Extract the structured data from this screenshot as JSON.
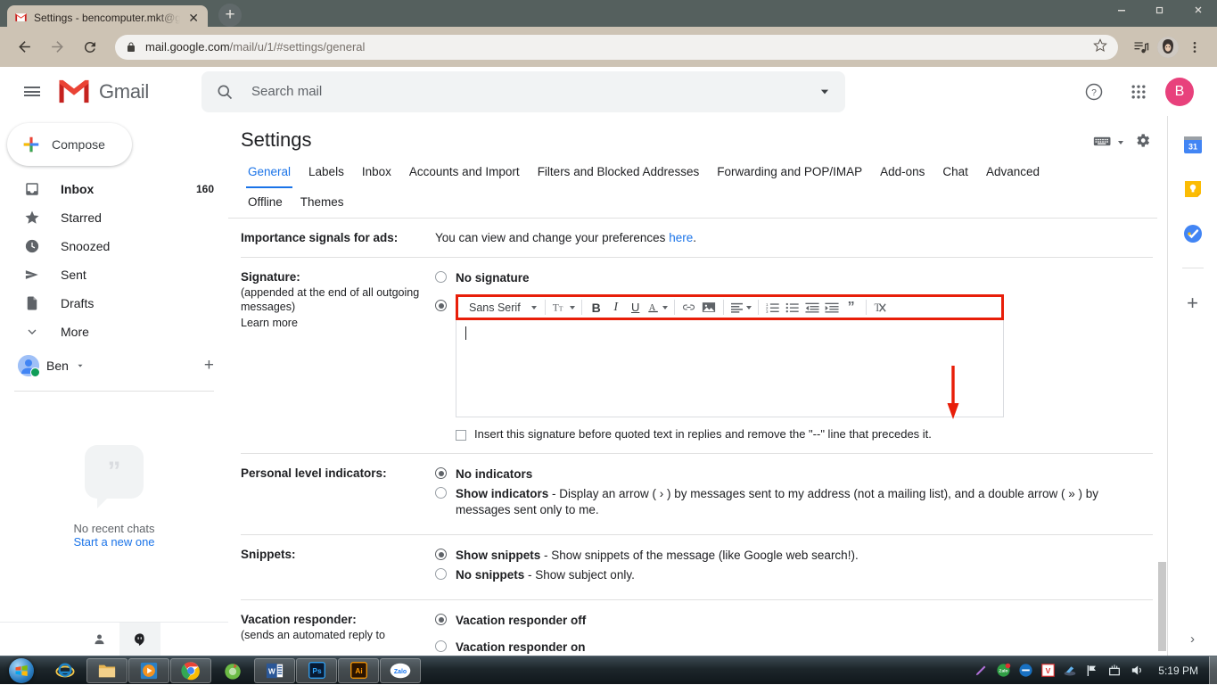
{
  "browser": {
    "tab_title": "Settings - bencomputer.mkt@gm",
    "tab_favicon": "gmail-icon",
    "new_tab_label": "+",
    "close_tab_label": "✕",
    "url_main": "mail.google.com",
    "url_path": "/mail/u/1/#settings/general",
    "window_minimize": "—",
    "window_maximize": "❐",
    "window_close": "✕"
  },
  "gmail": {
    "logo_text": "Gmail",
    "search_placeholder": "Search mail",
    "search_value": "",
    "compose_label": "Compose",
    "account_initial": "B",
    "nav": [
      {
        "label": "Inbox",
        "count": "160",
        "icon": "inbox-icon",
        "selected": true
      },
      {
        "label": "Starred",
        "count": "",
        "icon": "star-icon",
        "selected": false
      },
      {
        "label": "Snoozed",
        "count": "",
        "icon": "clock-icon",
        "selected": false
      },
      {
        "label": "Sent",
        "count": "",
        "icon": "send-icon",
        "selected": false
      },
      {
        "label": "Drafts",
        "count": "",
        "icon": "document-icon",
        "selected": false
      },
      {
        "label": "More",
        "count": "",
        "icon": "chevron-down-icon",
        "selected": false
      }
    ],
    "chat_user": "Ben",
    "chat_empty_text": "No recent chats",
    "chat_start_link": "Start a new one"
  },
  "settings": {
    "title": "Settings",
    "tabs_row1": [
      {
        "label": "General",
        "active": true
      },
      {
        "label": "Labels",
        "active": false
      },
      {
        "label": "Inbox",
        "active": false
      },
      {
        "label": "Accounts and Import",
        "active": false
      },
      {
        "label": "Filters and Blocked Addresses",
        "active": false
      },
      {
        "label": "Forwarding and POP/IMAP",
        "active": false
      },
      {
        "label": "Add-ons",
        "active": false
      },
      {
        "label": "Chat",
        "active": false
      },
      {
        "label": "Advanced",
        "active": false
      }
    ],
    "tabs_row2": [
      {
        "label": "Offline",
        "active": false
      },
      {
        "label": "Themes",
        "active": false
      }
    ],
    "importance": {
      "label": "Importance signals for ads:",
      "text": "You can view and change your preferences ",
      "link": "here",
      "text_end": "."
    },
    "signature": {
      "label": "Signature:",
      "sub": "(appended at the end of all outgoing messages)",
      "learn_more": "Learn more",
      "option_none": "No signature",
      "option_none_selected": false,
      "editor_selected": true,
      "font_name": "Sans Serif",
      "content": "",
      "checkbox_label": "Insert this signature before quoted text in replies and remove the \"--\" line that precedes it.",
      "checkbox_checked": false,
      "toolbar": [
        "font-family-selector",
        "font-size-icon",
        "bold-icon",
        "italic-icon",
        "underline-icon",
        "text-color-icon",
        "link-icon",
        "insert-image-icon",
        "align-icon",
        "numbered-list-icon",
        "bulleted-list-icon",
        "indent-less-icon",
        "indent-more-icon",
        "quote-icon",
        "remove-formatting-icon"
      ]
    },
    "personal_indicators": {
      "label": "Personal level indicators:",
      "option_no": "No indicators",
      "option_no_selected": true,
      "option_show_bold": "Show indicators",
      "option_show_rest": " - Display an arrow ( › ) by messages sent to my address (not a mailing list), and a double arrow ( » ) by messages sent only to me.",
      "option_show_selected": false
    },
    "snippets": {
      "label": "Snippets:",
      "option_show_bold": "Show snippets",
      "option_show_rest": " - Show snippets of the message (like Google web search!).",
      "option_show_selected": true,
      "option_no_bold": "No snippets",
      "option_no_rest": " - Show subject only.",
      "option_no_selected": false
    },
    "vacation": {
      "label": "Vacation responder:",
      "sub": "(sends an automated reply to",
      "option_off": "Vacation responder off",
      "option_off_selected": true,
      "option_on": "Vacation responder on",
      "option_on_selected": false
    }
  },
  "right_rail": {
    "items": [
      "calendar-icon",
      "keep-icon",
      "tasks-icon"
    ],
    "calendar_day": "31",
    "add_label": "+",
    "expand_label": "›"
  },
  "annotation": {
    "arrow": "red-down-arrow",
    "highlight_color": "#e81e09"
  },
  "taskbar": {
    "apps": [
      "internet-explorer-icon",
      "file-explorer-icon",
      "media-player-icon",
      "chrome-icon",
      "green-app-icon",
      "word-icon",
      "photoshop-icon",
      "illustrator-icon",
      "zalo-icon"
    ],
    "tray": [
      "pen-icon",
      "zalo-tray-icon",
      "blue-circle-icon",
      "v-app-icon",
      "network-tool-icon",
      "flag-icon",
      "monitor-icon",
      "volume-icon"
    ],
    "time": "5:19 PM"
  },
  "colors": {
    "accent_blue": "#1a73e8",
    "gmail_red": "#d93025",
    "annotation_red": "#e81e09",
    "avatar_pink": "#e8417c"
  }
}
